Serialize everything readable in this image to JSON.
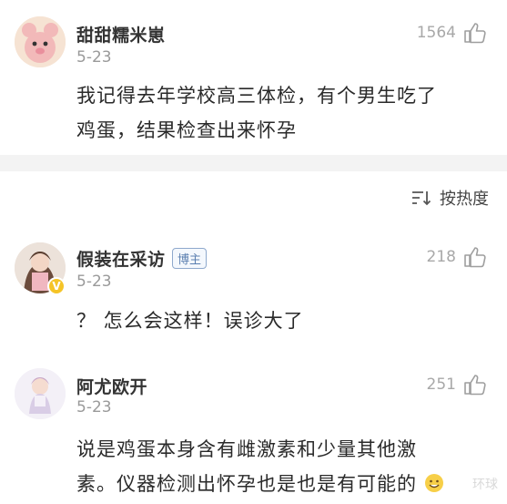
{
  "sort": {
    "label": "按热度",
    "icon": "sort-icon"
  },
  "comments": [
    {
      "username": "甜甜糯米崽",
      "date": "5-23",
      "likes": "1564",
      "text_lines": [
        "我记得去年学校高三体检，有个男生吃了",
        "鸡蛋，结果检查出来怀孕"
      ]
    },
    {
      "username": "假装在采访",
      "badge": "博主",
      "date": "5-23",
      "likes": "218",
      "text_lines": [
        "？ 怎么会这样！误诊大了"
      ]
    },
    {
      "username": "阿尤欧开",
      "date": "5-23",
      "likes": "251",
      "text_lines": [
        "说是鸡蛋本身含有雌激素和少量其他激",
        "素。仪器检测出怀孕也是也是有可能的"
      ]
    }
  ],
  "watermark": "环球"
}
